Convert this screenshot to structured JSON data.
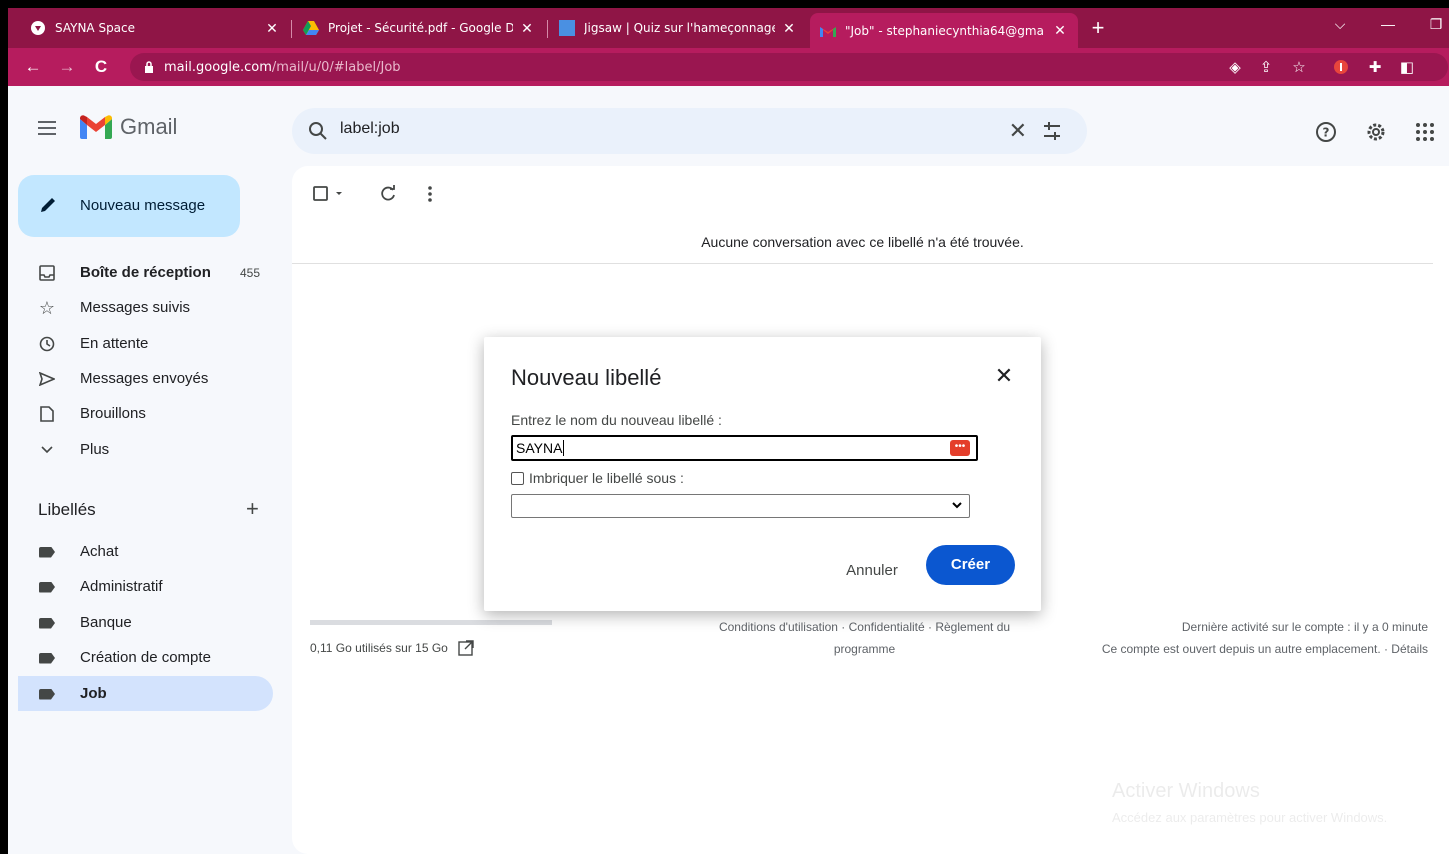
{
  "browser": {
    "tabs": [
      {
        "title": "SAYNA Space",
        "icon": "sayna-favicon"
      },
      {
        "title": "Projet - Sécurité.pdf - Google Dri",
        "icon": "google-drive-favicon"
      },
      {
        "title": "Jigsaw | Quiz sur l'hameçonnage",
        "icon": "jigsaw-favicon"
      },
      {
        "title": "\"Job\" - stephaniecynthia64@gma",
        "icon": "gmail-favicon",
        "active": true
      }
    ],
    "address": {
      "host": "mail.google.com",
      "path": "/mail/u/0/#label/Job"
    },
    "theme_color": "#b61c5e"
  },
  "gmail": {
    "logo_text": "Gmail",
    "search": {
      "value": "label:job"
    },
    "compose_label": "Nouveau message",
    "nav": [
      {
        "label": "Boîte de réception",
        "count": "455",
        "icon": "inbox-icon"
      },
      {
        "label": "Messages suivis",
        "icon": "star-icon"
      },
      {
        "label": "En attente",
        "icon": "clock-icon"
      },
      {
        "label": "Messages envoyés",
        "icon": "send-icon"
      },
      {
        "label": "Brouillons",
        "icon": "draft-icon"
      },
      {
        "label": "Plus",
        "icon": "chevron-down-icon"
      }
    ],
    "labels_heading": "Libellés",
    "labels": [
      {
        "label": "Achat"
      },
      {
        "label": "Administratif"
      },
      {
        "label": "Banque"
      },
      {
        "label": "Création de compte"
      },
      {
        "label": "Job",
        "selected": true
      }
    ],
    "empty_message": "Aucune conversation avec ce libellé n'a été trouvée.",
    "storage_text": "0,11 Go utilisés sur 15 Go",
    "footer_mid": {
      "line1": "Conditions d'utilisation · Confidentialité · Règlement du",
      "line2": "programme"
    },
    "footer_right": {
      "line1": "Dernière activité sur le compte : il y a 0 minute",
      "line2": "Ce compte est ouvert depuis un autre emplacement. · Détails"
    },
    "watermark": {
      "line1": "Activer Windows",
      "line2": "Accédez aux paramètres pour activer Windows."
    }
  },
  "dialog": {
    "title": "Nouveau libellé",
    "prompt": "Entrez le nom du nouveau libellé :",
    "input_value": "SAYNA",
    "nest_label": "Imbriquer le libellé sous :",
    "cancel_label": "Annuler",
    "create_label": "Créer"
  }
}
